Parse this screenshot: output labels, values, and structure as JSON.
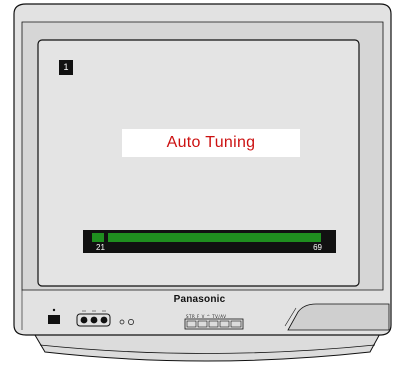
{
  "tv": {
    "brand": "Panasonic",
    "colors": {
      "body": "#e2e2e2",
      "bezel": "#d6d6d6",
      "screen": "#e4e4e4",
      "outline": "#111111"
    }
  },
  "osd": {
    "channel_number": "1",
    "title": "Auto Tuning",
    "title_color": "#cc1111",
    "progress": {
      "range_start_label": "21",
      "range_end_label": "69",
      "fill_color": "#1f8f1f",
      "marker_color": "#1f8f1f"
    }
  },
  "controls": {
    "front_panel_labels": "STR  F  V  ^  TV/AV",
    "icons": [
      "power-button",
      "av-input-jacks",
      "indicator-leds",
      "front-control-buttons",
      "side-panel"
    ]
  }
}
